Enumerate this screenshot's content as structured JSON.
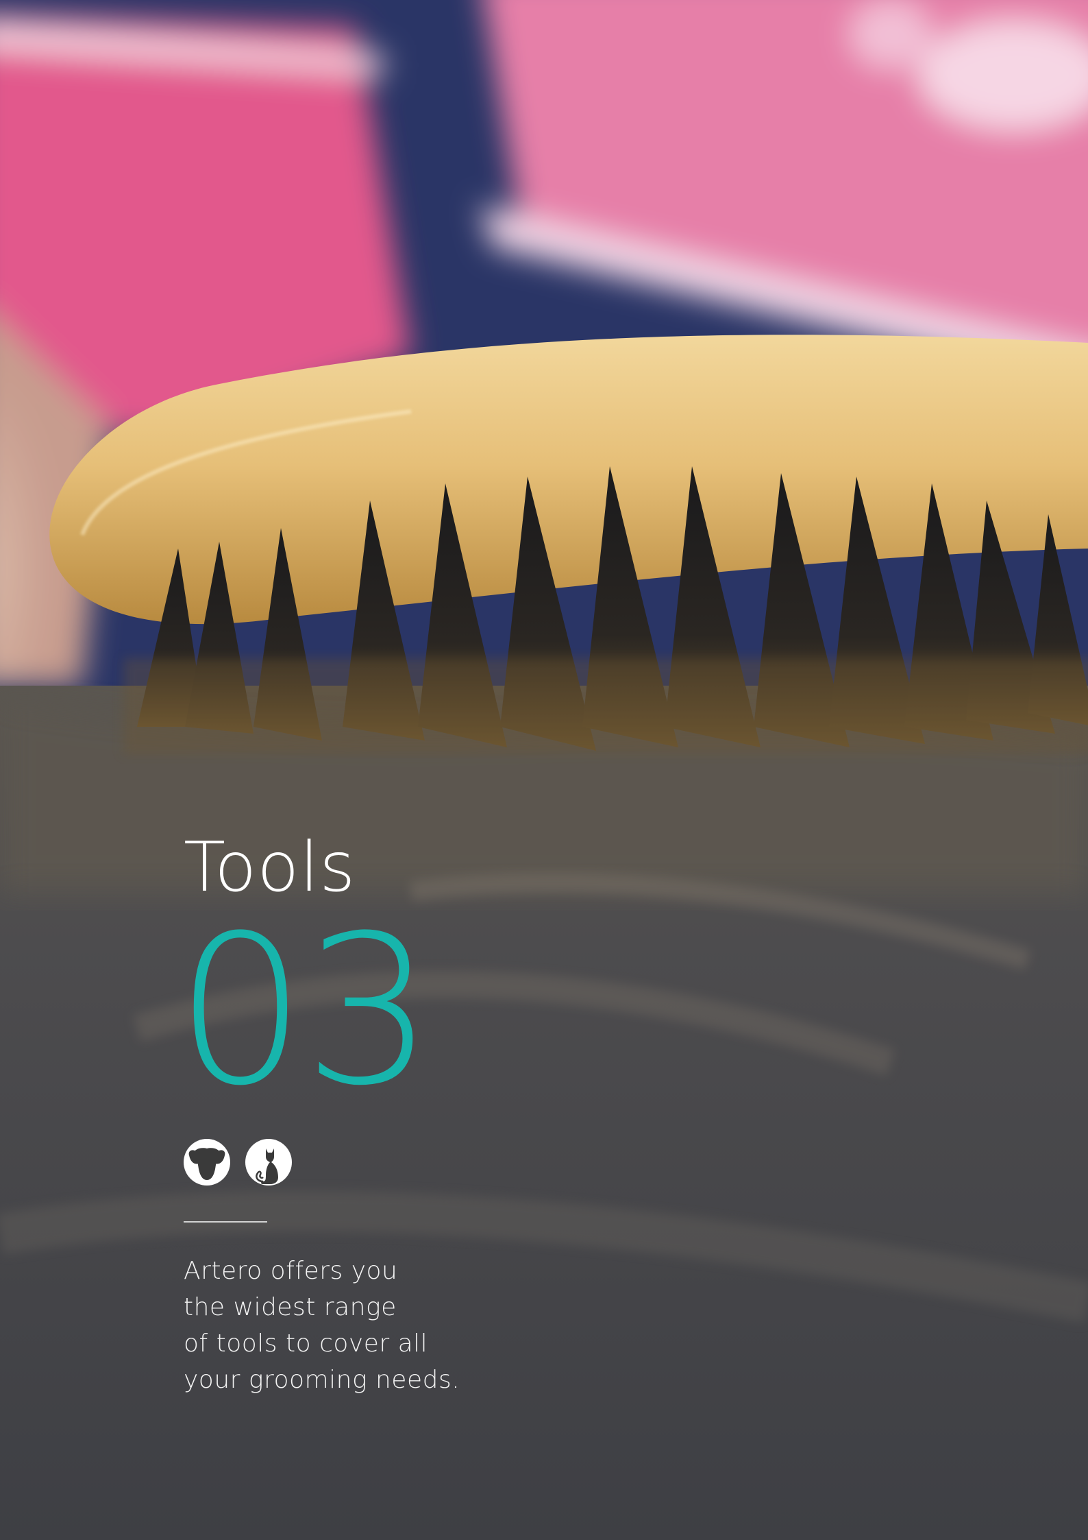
{
  "section": {
    "title": "Tools",
    "number": "03"
  },
  "icons": [
    "dog-icon",
    "cat-icon"
  ],
  "description": {
    "lines": [
      "Artero offers you",
      "the widest range",
      "of tools to cover all",
      "your grooming needs."
    ]
  },
  "colors": {
    "accent": "#17b5ac",
    "text": "#ffffff"
  }
}
